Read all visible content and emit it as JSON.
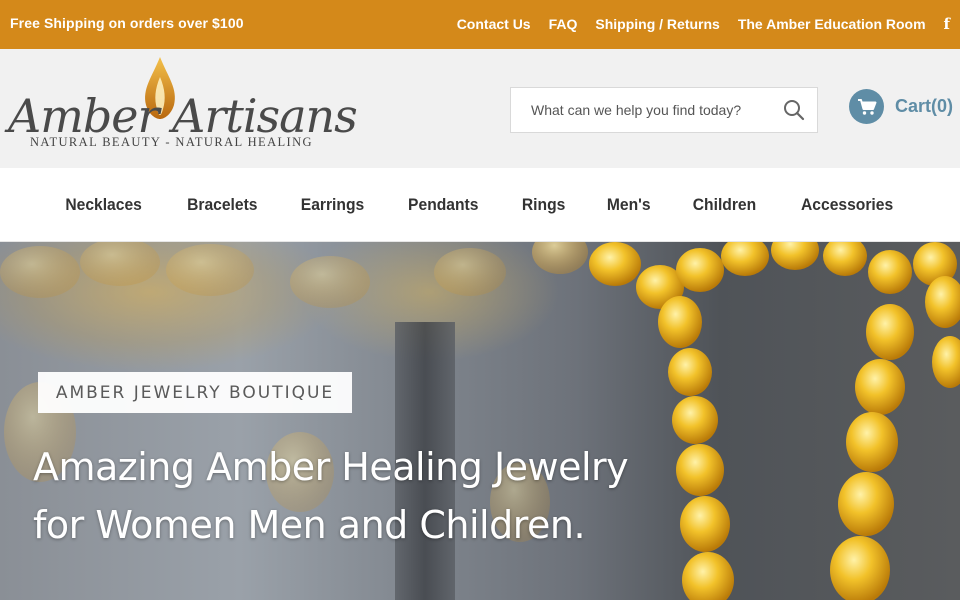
{
  "topbar": {
    "promo": "Free Shipping on orders over $100",
    "links": [
      "Contact Us",
      "FAQ",
      "Shipping / Returns",
      "The Amber Education Room"
    ],
    "facebook_icon": "f"
  },
  "logo": {
    "wordmark": "Amber Artisans",
    "tagline": "NATURAL BEAUTY - NATURAL HEALING"
  },
  "search": {
    "placeholder": "What can we help you find today?",
    "icon": "search-icon"
  },
  "cart": {
    "label": "Cart(0)",
    "icon": "cart-icon"
  },
  "nav": {
    "items": [
      "Necklaces",
      "Bracelets",
      "Earrings",
      "Pendants",
      "Rings",
      "Men's",
      "Children",
      "Accessories"
    ]
  },
  "hero": {
    "badge": "AMBER JEWELRY BOUTIQUE",
    "headline_line1": "Amazing Amber Healing Jewelry",
    "headline_line2": "for Women Men and Children."
  },
  "colors": {
    "topbar": "#d4891a",
    "header_bg": "#f1f1f1",
    "cart_accent": "#5f8da6",
    "nav_text": "#333333"
  }
}
